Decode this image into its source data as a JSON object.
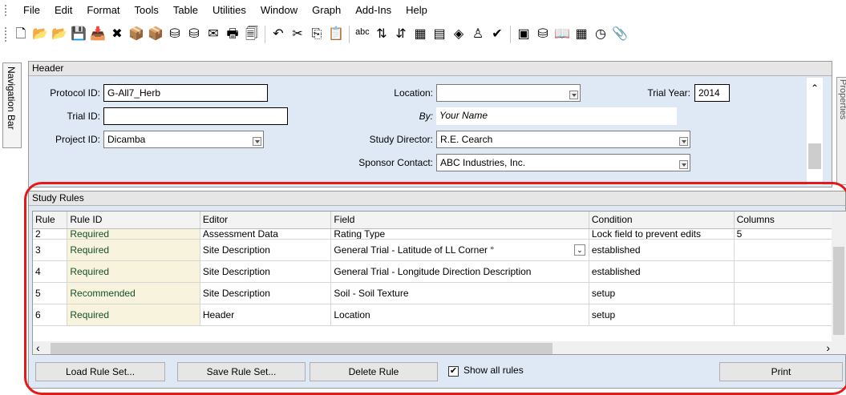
{
  "menu": [
    "File",
    "Edit",
    "Format",
    "Tools",
    "Table",
    "Utilities",
    "Window",
    "Graph",
    "Add-Ins",
    "Help"
  ],
  "toolbar_icons": [
    {
      "name": "new-document-icon",
      "glyph": "🗋"
    },
    {
      "name": "open-folder-icon",
      "glyph": "📂"
    },
    {
      "name": "open-folder-2-icon",
      "glyph": "📂"
    },
    {
      "name": "save-icon",
      "glyph": "💾"
    },
    {
      "name": "save-as-icon",
      "glyph": "📥"
    },
    {
      "name": "delete-icon",
      "glyph": "✖"
    },
    {
      "name": "import-icon",
      "glyph": "📦"
    },
    {
      "name": "export-icon",
      "glyph": "📦"
    },
    {
      "name": "db-import-icon",
      "glyph": "⛁"
    },
    {
      "name": "db-export-icon",
      "glyph": "⛁"
    },
    {
      "name": "email-icon",
      "glyph": "✉"
    },
    {
      "name": "print-icon",
      "glyph": "🖶"
    },
    {
      "name": "print-preview-icon",
      "glyph": "🗐"
    },
    {
      "name": "sep"
    },
    {
      "name": "undo-icon",
      "glyph": "↶"
    },
    {
      "name": "cut-icon",
      "glyph": "✂"
    },
    {
      "name": "copy-icon",
      "glyph": "⎘"
    },
    {
      "name": "paste-icon",
      "glyph": "📋"
    },
    {
      "name": "sep"
    },
    {
      "name": "spell-check-icon",
      "glyph": "ᵃᵇᶜ"
    },
    {
      "name": "sort-ascending-icon",
      "glyph": "⇅"
    },
    {
      "name": "sort-descending-icon",
      "glyph": "⇵"
    },
    {
      "name": "filter-icon",
      "glyph": "▦"
    },
    {
      "name": "chart-icon",
      "glyph": "▤"
    },
    {
      "name": "layers-icon",
      "glyph": "◈"
    },
    {
      "name": "person-icon",
      "glyph": "♙"
    },
    {
      "name": "check-icon",
      "glyph": "✔"
    },
    {
      "name": "sep"
    },
    {
      "name": "report-icon",
      "glyph": "▣"
    },
    {
      "name": "database-icon",
      "glyph": "⛁"
    },
    {
      "name": "book-icon",
      "glyph": "📖"
    },
    {
      "name": "calculator-icon",
      "glyph": "▦"
    },
    {
      "name": "clock-icon",
      "glyph": "◷"
    },
    {
      "name": "paperclip-icon",
      "glyph": "📎"
    }
  ],
  "navbar_label": "Navigation Bar",
  "properties_label": "Properties",
  "header": {
    "title": "Header",
    "protocol_id_label": "Protocol ID:",
    "protocol_id": "G-All7_Herb",
    "trial_id_label": "Trial ID:",
    "trial_id": "",
    "project_id_label": "Project ID:",
    "project_id": "Dicamba",
    "location_label": "Location:",
    "location": "",
    "by_label": "By:",
    "by": "Your Name",
    "study_director_label": "Study Director:",
    "study_director": "R.E. Cearch",
    "sponsor_contact_label": "Sponsor Contact:",
    "sponsor_contact": "ABC Industries, Inc.",
    "trial_year_label": "Trial Year:",
    "trial_year": "2014"
  },
  "rules": {
    "title": "Study Rules",
    "columns": [
      "Rule",
      "Rule ID",
      "Editor",
      "Field",
      "Condition",
      "Columns"
    ],
    "rows": [
      {
        "rule": "2",
        "rule_id": "Required",
        "editor": "Assessment Data",
        "field": "Rating Type",
        "condition": "Lock field to prevent edits",
        "columns": "5"
      },
      {
        "rule": "3",
        "rule_id": "Required",
        "editor": "Site Description",
        "field": "General Trial - Latitude of LL Corner °",
        "condition": "established",
        "columns": ""
      },
      {
        "rule": "4",
        "rule_id": "Required",
        "editor": "Site Description",
        "field": "General Trial - Longitude Direction Description",
        "condition": "established",
        "columns": ""
      },
      {
        "rule": "5",
        "rule_id": "Recommended",
        "editor": "Site Description",
        "field": "Soil - Soil Texture",
        "condition": "setup",
        "columns": ""
      },
      {
        "rule": "6",
        "rule_id": "Required",
        "editor": "Header",
        "field": "Location",
        "condition": "setup",
        "columns": ""
      }
    ],
    "buttons": {
      "load": "Load Rule Set...",
      "save": "Save Rule Set...",
      "delete": "Delete Rule",
      "print": "Print"
    },
    "show_all_label": "Show all rules",
    "show_all_checked": true
  },
  "colors": {
    "panel_bg": "#dfe9f5",
    "rule_id_bg": "#f7f3dc",
    "highlight": "#e31a1a"
  }
}
